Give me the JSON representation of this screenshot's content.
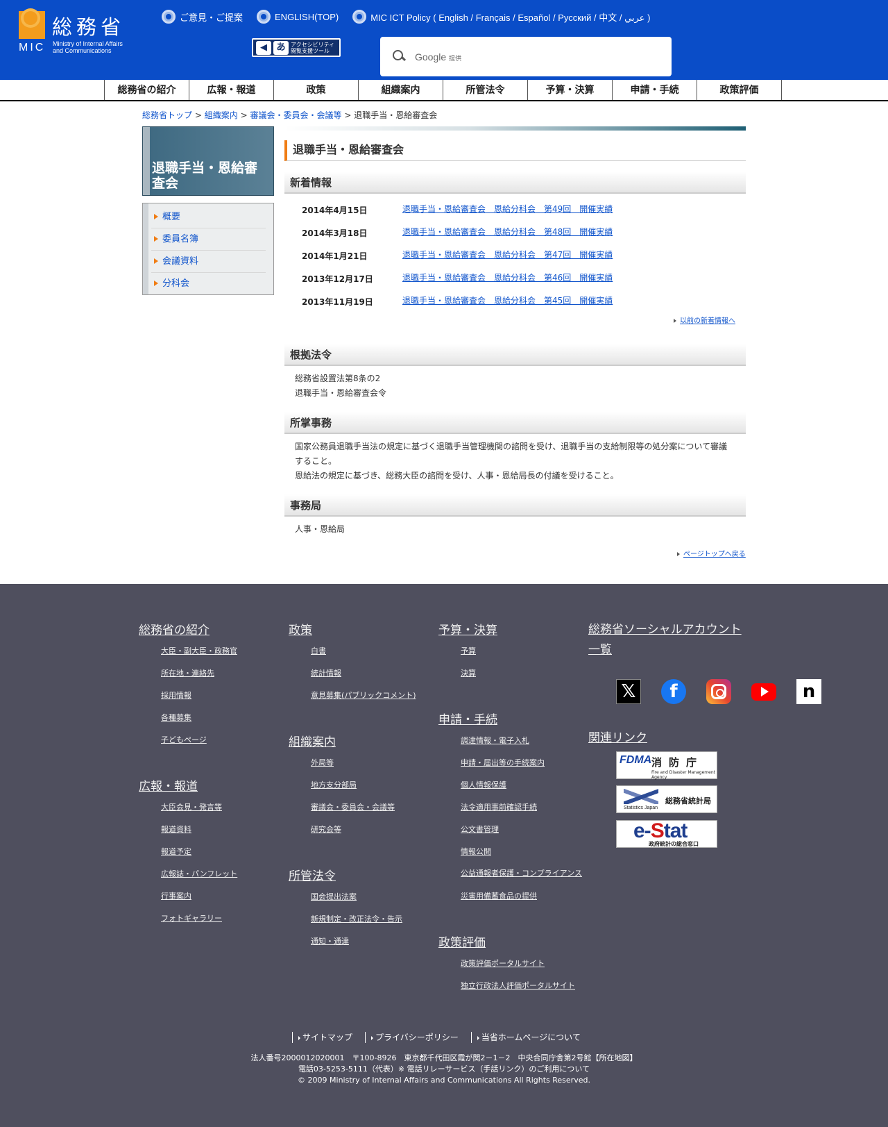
{
  "header": {
    "logo_ja": "総務省",
    "logo_mic": "MIC",
    "logo_en_1": "Ministry of Internal Affairs",
    "logo_en_2": "and Communications",
    "top_links": [
      "ご意見・ご提案",
      "ENGLISH(TOP)",
      "MIC ICT Policy ( English / Français / Español / Русский / 中文 / عربي )"
    ],
    "access_text_1": "アクセシビリティ",
    "access_text_2": "閲覧支援ツール",
    "search_brand": "Google",
    "search_brand_suffix": "提供",
    "search_placeholder": ""
  },
  "gnav": [
    "総務省の紹介",
    "広報・報道",
    "政策",
    "組織案内",
    "所管法令",
    "予算・決算",
    "申請・手続",
    "政策評価"
  ],
  "breadcrumb": {
    "items": [
      "総務省トップ",
      "組織案内",
      "審議会・委員会・会議等"
    ],
    "current": "退職手当・恩給審査会",
    "separator": ">"
  },
  "sidebar": {
    "title": "退職手当・恩給審査会",
    "menu": [
      "概要",
      "委員名簿",
      "会議資料",
      "分科会"
    ]
  },
  "main": {
    "title": "退職手当・恩給審査会",
    "news_heading": "新着情報",
    "news": [
      {
        "date": "2014年4月15日",
        "link": "退職手当・恩給審査会　恩給分科会　第49回　開催実績"
      },
      {
        "date": "2014年3月18日",
        "link": "退職手当・恩給審査会　恩給分科会　第48回　開催実績"
      },
      {
        "date": "2014年1月21日",
        "link": "退職手当・恩給審査会　恩給分科会　第47回　開催実績"
      },
      {
        "date": "2013年12月17日",
        "link": "退職手当・恩給審査会　恩給分科会　第46回　開催実績"
      },
      {
        "date": "2013年11月19日",
        "link": "退職手当・恩給審査会　恩給分科会　第45回　開催実績"
      }
    ],
    "news_more": "以前の新着情報へ",
    "law_heading": "根拠法令",
    "law_lines": [
      "総務省設置法第8条の2",
      "退職手当・恩給審査会令"
    ],
    "duty_heading": "所掌事務",
    "duty_lines": [
      "国家公務員退職手当法の規定に基づく退職手当管理機関の諮問を受け、退職手当の支給制限等の処分案について審議すること。",
      "恩給法の規定に基づき、総務大臣の諮問を受け、人事・恩給局長の付議を受けること。"
    ],
    "office_heading": "事務局",
    "office_line": "人事・恩給局",
    "page_top": "ページトップへ戻る"
  },
  "footer": {
    "col1": {
      "head1": "総務省の紹介",
      "items1": [
        "大臣・副大臣・政務官",
        "所在地・連絡先",
        "採用情報",
        "各種募集",
        "子どもページ"
      ],
      "head2": "広報・報道",
      "items2": [
        "大臣会見・発言等",
        "報道資料",
        "報道予定",
        "広報誌・パンフレット",
        "行事案内",
        "フォトギャラリー"
      ]
    },
    "col2": {
      "head1": "政策",
      "items1": [
        "白書",
        "統計情報",
        "意見募集(パブリックコメント)"
      ],
      "head2": "組織案内",
      "items2": [
        "外局等",
        "地方支分部局",
        "審議会・委員会・会議等",
        "研究会等"
      ],
      "head3": "所管法令",
      "items3": [
        "国会提出法案",
        "新規制定・改正法令・告示",
        "通知・通達"
      ]
    },
    "col3": {
      "head1": "予算・決算",
      "items1": [
        "予算",
        "決算"
      ],
      "head2": "申請・手続",
      "items2": [
        "調達情報・電子入札",
        "申請・届出等の手続案内",
        "個人情報保護",
        "法令適用事前確認手続",
        "公文書管理",
        "情報公開",
        "公益通報者保護・コンプライアンス",
        "災害用備蓄食品の提供"
      ],
      "head3": "政策評価",
      "items3": [
        "政策評価ポータルサイト",
        "独立行政法人評価ポータルサイト"
      ]
    },
    "col4": {
      "social_head": "総務省ソーシャルアカウント一覧",
      "social": [
        "x-icon",
        "facebook-icon",
        "instagram-icon",
        "youtube-icon",
        "note-icon"
      ],
      "related_head": "関連リンク",
      "fdma_l": "FDMA",
      "fdma_r": "消防庁",
      "fdma_s": "Fire and Disaster Management Agency",
      "stat_r": "総務省統計局",
      "stat_s": "Statistics Japan",
      "estat_1": "e-",
      "estat_2": "S",
      "estat_3": "tat",
      "estat_s": "政府統計の総合窓口"
    },
    "bottom_links": [
      "サイトマップ",
      "プライバシーポリシー",
      "当省ホームページについて"
    ],
    "addr_line1": "法人番号2000012020001　〒100-8926　東京都千代田区霞が関2－1－2　中央合同庁舎第2号館【",
    "addr_map": "所在地図",
    "addr_end": "】",
    "tel": "電話03-5253-5111（代表）",
    "relay": "※ 電話リレーサービス（手話リンク）のご利用について",
    "copyright": "© 2009 Ministry of Internal Affairs and Communications All Rights Reserved."
  }
}
